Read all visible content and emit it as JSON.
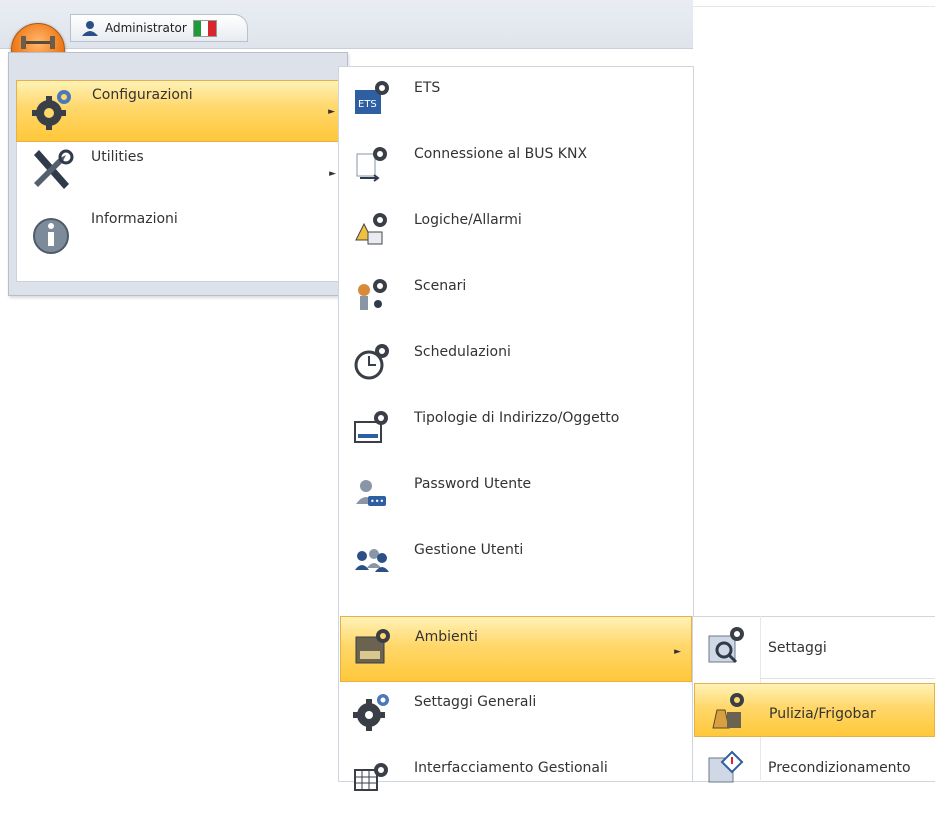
{
  "header": {
    "user_name": "Administrator",
    "flag_colors": [
      "#1f9a3a",
      "#ffffff",
      "#d8262c"
    ]
  },
  "menu1": {
    "items": [
      {
        "label": "Configurazioni",
        "icon": "gear-icon",
        "highlighted": true,
        "has_submenu": true
      },
      {
        "label": "Utilities",
        "icon": "tools-icon",
        "highlighted": false,
        "has_submenu": true
      },
      {
        "label": "Informazioni",
        "icon": "info-icon",
        "highlighted": false,
        "has_submenu": false
      }
    ]
  },
  "menu2": {
    "items": [
      {
        "label": "ETS",
        "icon": "ets-icon"
      },
      {
        "label": "Connessione al BUS KNX",
        "icon": "bus-connection-icon"
      },
      {
        "label": "Logiche/Allarmi",
        "icon": "logic-alarm-icon"
      },
      {
        "label": "Scenari",
        "icon": "scenario-icon"
      },
      {
        "label": "Schedulazioni",
        "icon": "clock-icon"
      },
      {
        "label": "Tipologie di Indirizzo/Oggetto",
        "icon": "address-type-icon"
      },
      {
        "label": "Password Utente",
        "icon": "password-user-icon"
      },
      {
        "label": "Gestione Utenti",
        "icon": "users-icon"
      },
      {
        "label": "Ambienti",
        "icon": "rooms-icon",
        "highlighted": true,
        "has_submenu": true
      },
      {
        "label": "Settaggi Generali",
        "icon": "general-settings-icon"
      },
      {
        "label": "Interfacciamento Gestionali",
        "icon": "management-interface-icon"
      }
    ]
  },
  "menu3": {
    "items": [
      {
        "label": "Settaggi",
        "icon": "room-settings-icon"
      },
      {
        "label": "Pulizia/Frigobar",
        "icon": "cleaning-minibar-icon",
        "highlighted": true
      },
      {
        "label": "Precondizionamento",
        "icon": "preconditioning-icon"
      }
    ]
  },
  "arrow_glyph": "►"
}
